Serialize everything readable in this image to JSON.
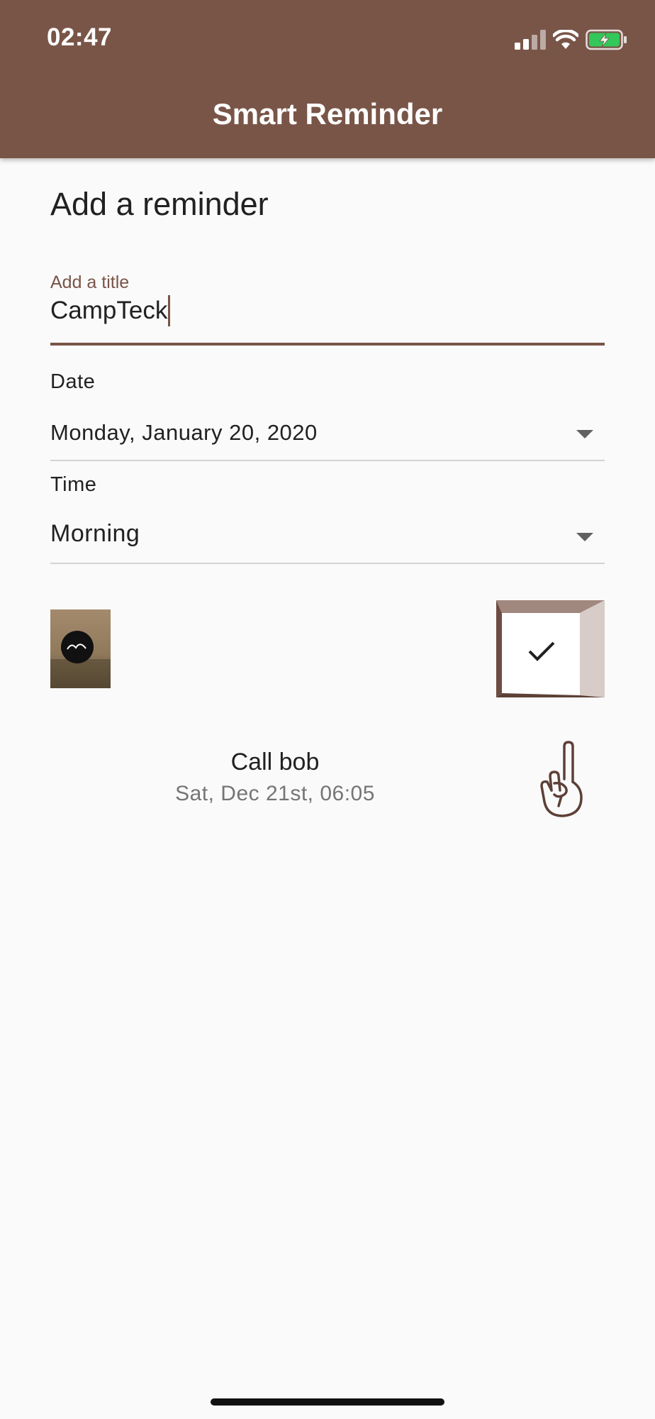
{
  "status_bar": {
    "time": "02:47",
    "icons": [
      "signal-icon",
      "wifi-icon",
      "battery-charging-icon"
    ]
  },
  "app_bar": {
    "title": "Smart Reminder",
    "color": "#795548"
  },
  "form": {
    "heading": "Add a reminder",
    "title_field": {
      "label": "Add a title",
      "value": "CampTeck"
    },
    "date": {
      "label": "Date",
      "value": "Monday, January 20, 2020"
    },
    "time": {
      "label": "Time",
      "value": "Morning"
    },
    "image_thumbnail_icon": "image-thumbnail",
    "submit_icon": "check-icon"
  },
  "reminders": [
    {
      "title": "Call bob",
      "datetime": "Sat, Dec 21st, 06:05",
      "icon": "reminder-hand-icon"
    }
  ],
  "colors": {
    "accent": "#795548",
    "background": "#fafafa",
    "secondary_text": "#757575"
  }
}
